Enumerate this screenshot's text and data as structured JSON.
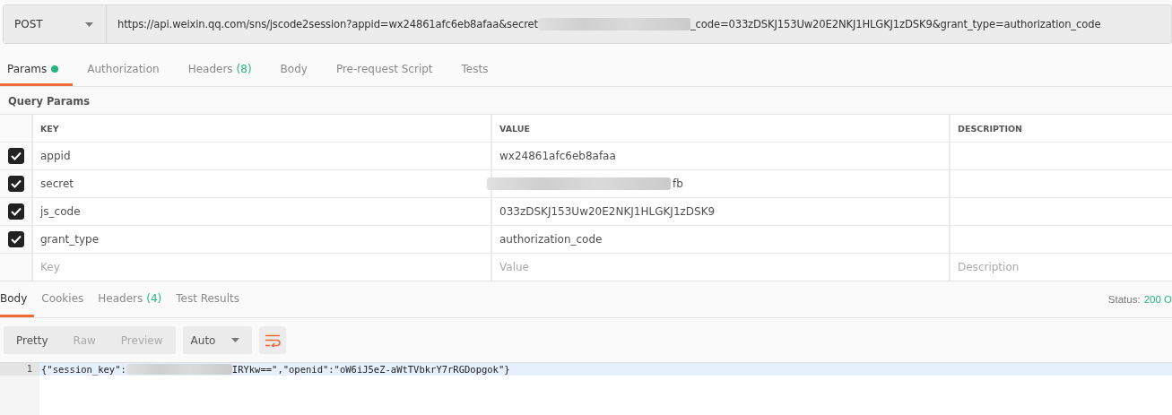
{
  "request": {
    "method": "POST",
    "url_before": "https://api.weixin.qq.com/sns/jscode2session?appid=wx24861afc6eb8afaa&secret",
    "url_redacted": true,
    "url_after": "_code=033zDSKJ153Uw20E2NKJ1HLGKJ1zDSK9&grant_type=authorization_code"
  },
  "request_tabs": [
    {
      "label": "Params",
      "selected": true,
      "dot": true
    },
    {
      "label": "Authorization",
      "selected": false
    },
    {
      "label": "Headers",
      "count": "(8)",
      "selected": false
    },
    {
      "label": "Body",
      "selected": false
    },
    {
      "label": "Pre-request Script",
      "selected": false
    },
    {
      "label": "Tests",
      "selected": false
    }
  ],
  "query_params": {
    "title": "Query Params",
    "columns": [
      "KEY",
      "VALUE",
      "DESCRIPTION"
    ],
    "rows": [
      {
        "checked": true,
        "key": "appid",
        "value": "wx24861afc6eb8afaa",
        "redacted": false
      },
      {
        "checked": true,
        "key": "secret",
        "value": "fb",
        "redacted": true
      },
      {
        "checked": true,
        "key": "js_code",
        "value": "033zDSKJ153Uw20E2NKJ1HLGKJ1zDSK9",
        "redacted": false
      },
      {
        "checked": true,
        "key": "grant_type",
        "value": "authorization_code",
        "redacted": false
      }
    ],
    "new_row": [
      {
        "placeholder": "Key"
      },
      {
        "placeholder": "Value"
      },
      {
        "placeholder": "Description"
      }
    ]
  },
  "response_tabs": [
    {
      "label": "Body",
      "selected": true
    },
    {
      "label": "Cookies",
      "selected": false
    },
    {
      "label": "Headers",
      "count": "(4)",
      "selected": false
    },
    {
      "label": "Test Results",
      "selected": false
    }
  ],
  "status": {
    "label": "Status:",
    "value": "200 O"
  },
  "view_modes": [
    {
      "label": "Pretty",
      "selected": true
    },
    {
      "label": "Raw",
      "selected": false
    },
    {
      "label": "Preview",
      "selected": false
    }
  ],
  "format": "Auto",
  "wrap_enabled": true,
  "response_lines": [
    {
      "number": "1",
      "before": "{\"session_key\":",
      "redacted": true,
      "after": "IRYkw==\",\"openid\":\"oW6iJ5eZ-aWtTVbkrY7rRGDopgok\"}"
    }
  ]
}
